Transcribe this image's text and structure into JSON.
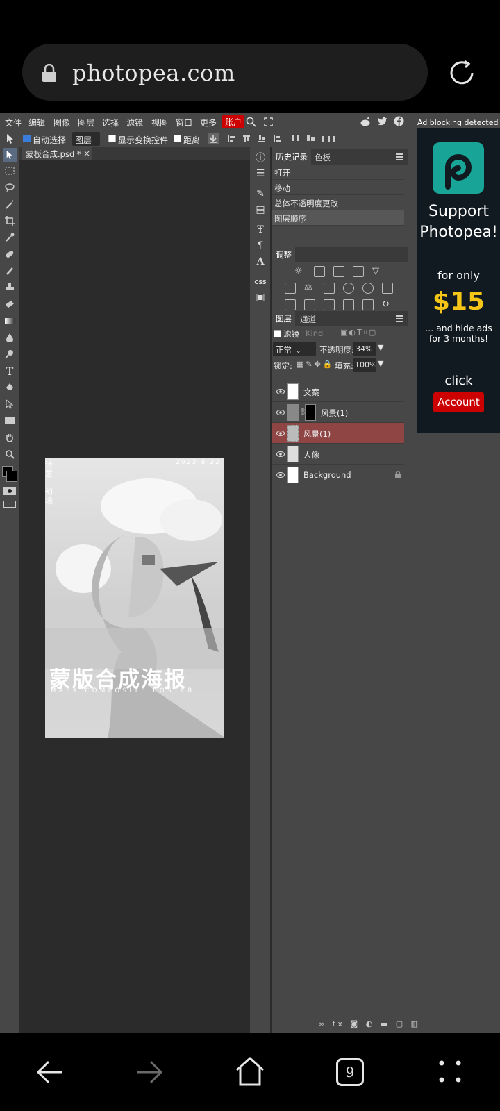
{
  "browser": {
    "url": "photopea.com"
  },
  "menu": {
    "items": [
      "文件",
      "编辑",
      "图像",
      "图层",
      "选择",
      "滤镜",
      "视图",
      "窗口",
      "更多"
    ],
    "account": "账户",
    "ad_blocking": "Ad blocking detected"
  },
  "options": {
    "auto_select": "自动选择",
    "layer_select": "图层",
    "show_transform": "显示变换控件",
    "distance": "距离"
  },
  "document": {
    "tab": "蒙板合成.psd *",
    "close": "×"
  },
  "poster": {
    "title": "蒙版合成海报",
    "subtitle": "MASK COMPOSITE POSTER",
    "date": "2023-8-22",
    "side_text": "诗 意 · 幻 境"
  },
  "history": {
    "tabs": [
      "历史记录",
      "色板"
    ],
    "items": [
      "打开",
      "移动",
      "总体不透明度更改",
      "图层顺序"
    ]
  },
  "adjust": {
    "title": "调整"
  },
  "layers": {
    "tabs": [
      "图层",
      "通道"
    ],
    "filter_label": "滤镜",
    "kind": "Kind",
    "blend": "正常",
    "opacity_label": "不透明度:",
    "opacity": "34%",
    "lock_label": "锁定:",
    "fill_label": "填充:",
    "fill": "100%",
    "list": [
      {
        "name": "文案"
      },
      {
        "name": "风景(1)"
      },
      {
        "name": "风景(1)"
      },
      {
        "name": "人像"
      },
      {
        "name": "Background"
      }
    ]
  },
  "ad": {
    "support": "Support Photopea!",
    "for_only": "for only",
    "price": "$15",
    "hide": "... and hide ads for 3 months!",
    "click": "click",
    "button": "Account"
  },
  "nav": {
    "tab_count": "9"
  },
  "colors": {
    "accent_red": "#cc0000",
    "selected_layer": "#904545",
    "ad_price": "#f5c518",
    "ad_logo": "#18a497"
  }
}
